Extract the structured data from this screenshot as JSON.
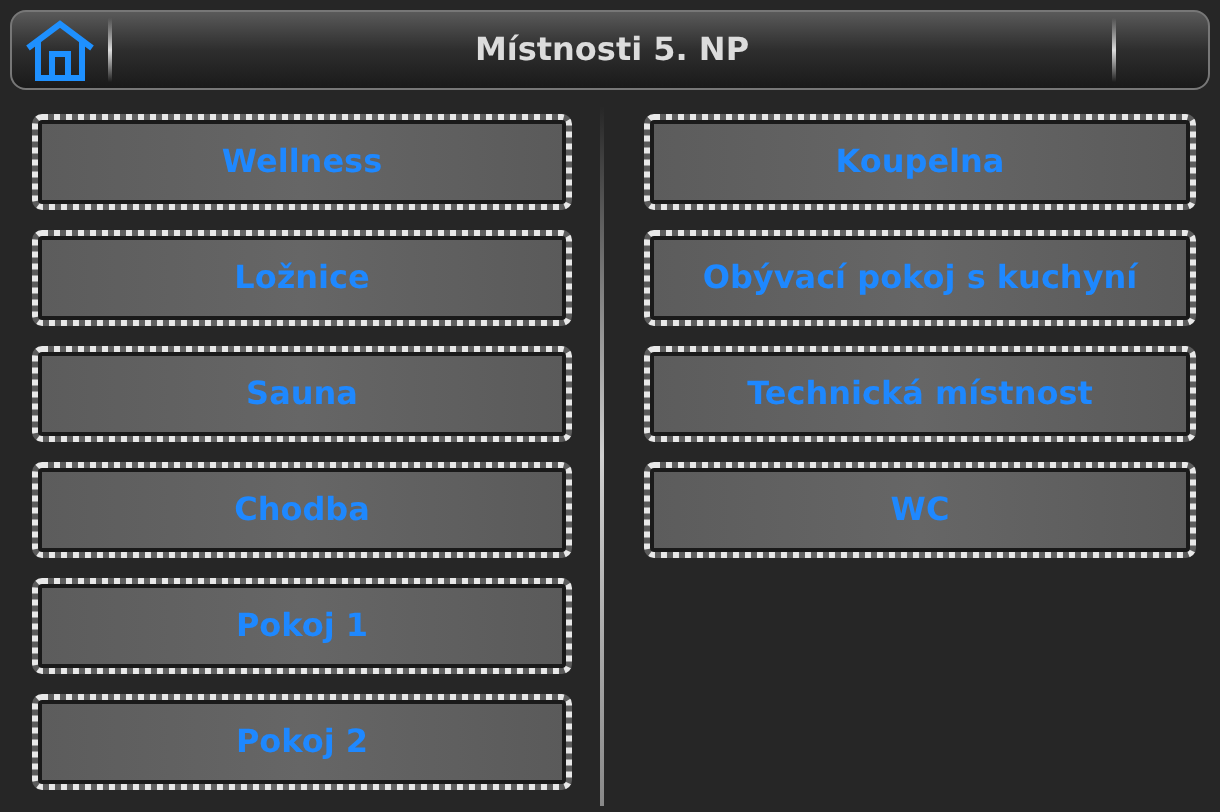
{
  "header": {
    "title": "Místnosti 5. NP"
  },
  "columns": [
    {
      "rooms": [
        "Wellness",
        "Ložnice",
        "Sauna",
        "Chodba",
        "Pokoj 1",
        "Pokoj 2"
      ]
    },
    {
      "rooms": [
        "Koupelna",
        "Obývací pokoj s kuchyní",
        "Technická místnost",
        "WC"
      ]
    }
  ]
}
